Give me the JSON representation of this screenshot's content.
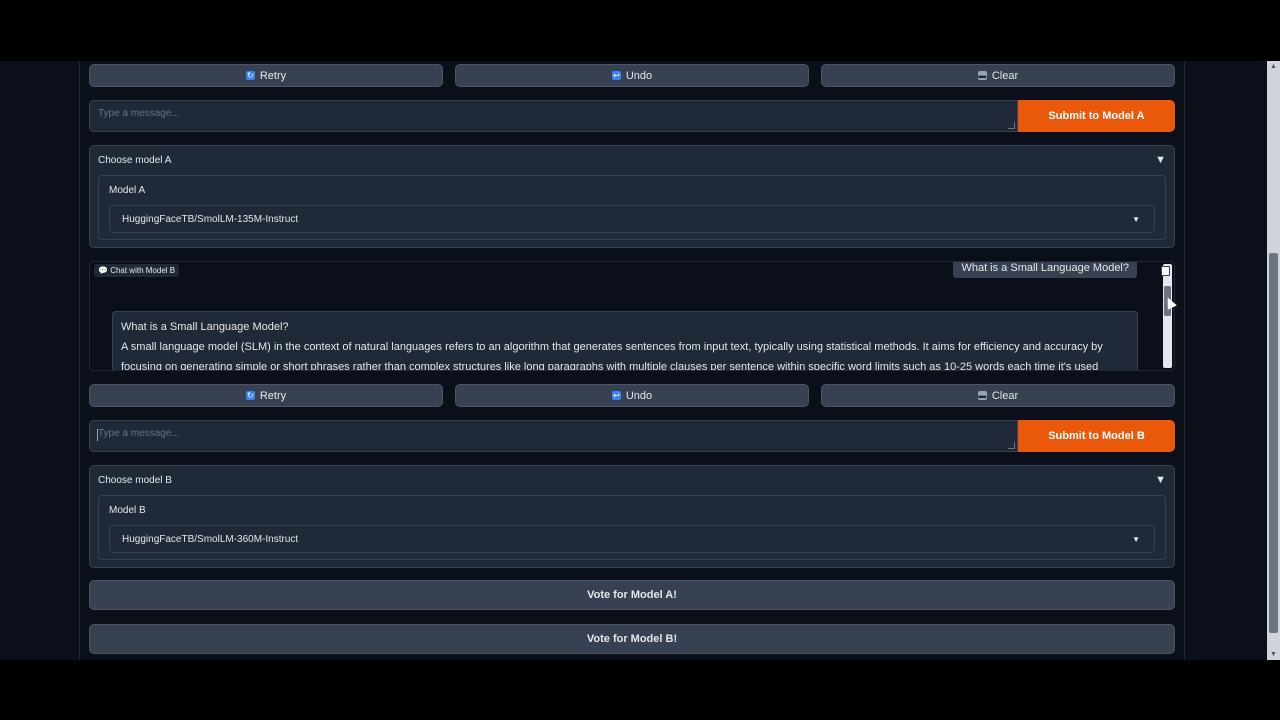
{
  "panel_a": {
    "retry_label": "Retry",
    "undo_label": "Undo",
    "clear_label": "Clear",
    "input_placeholder": "Type a message...",
    "submit_label": "Submit to Model A",
    "accordion_title": "Choose model A",
    "model_label": "Model A",
    "model_value": "HuggingFaceTB/SmolLM-135M-Instruct"
  },
  "chat_b": {
    "label": "Chat with Model B",
    "user_message": "What is a Small Language Model?",
    "bot_line1": "What is a Small Language Model?",
    "bot_line2": "A small language model (SLM) in the context of natural languages refers to an algorithm that generates sentences from input text, typically using statistical methods. It aims for efficiency and accuracy by",
    "bot_line3": "focusing on generating simple or short phrases rather than complex structures like long paragraphs with multiple clauses per sentence within specific word limits such as 10-25 words each time it's used"
  },
  "panel_b": {
    "retry_label": "Retry",
    "undo_label": "Undo",
    "clear_label": "Clear",
    "input_placeholder": "Type a message...",
    "submit_label": "Submit to Model B",
    "accordion_title": "Choose model B",
    "model_label": "Model B",
    "model_value": "HuggingFaceTB/SmolLM-360M-Instruct"
  },
  "vote": {
    "a_label": "Vote for Model A!",
    "b_label": "Vote for Model B!"
  },
  "colors": {
    "background": "#0b0f19",
    "accent": "#ea580c",
    "button": "#374151"
  }
}
